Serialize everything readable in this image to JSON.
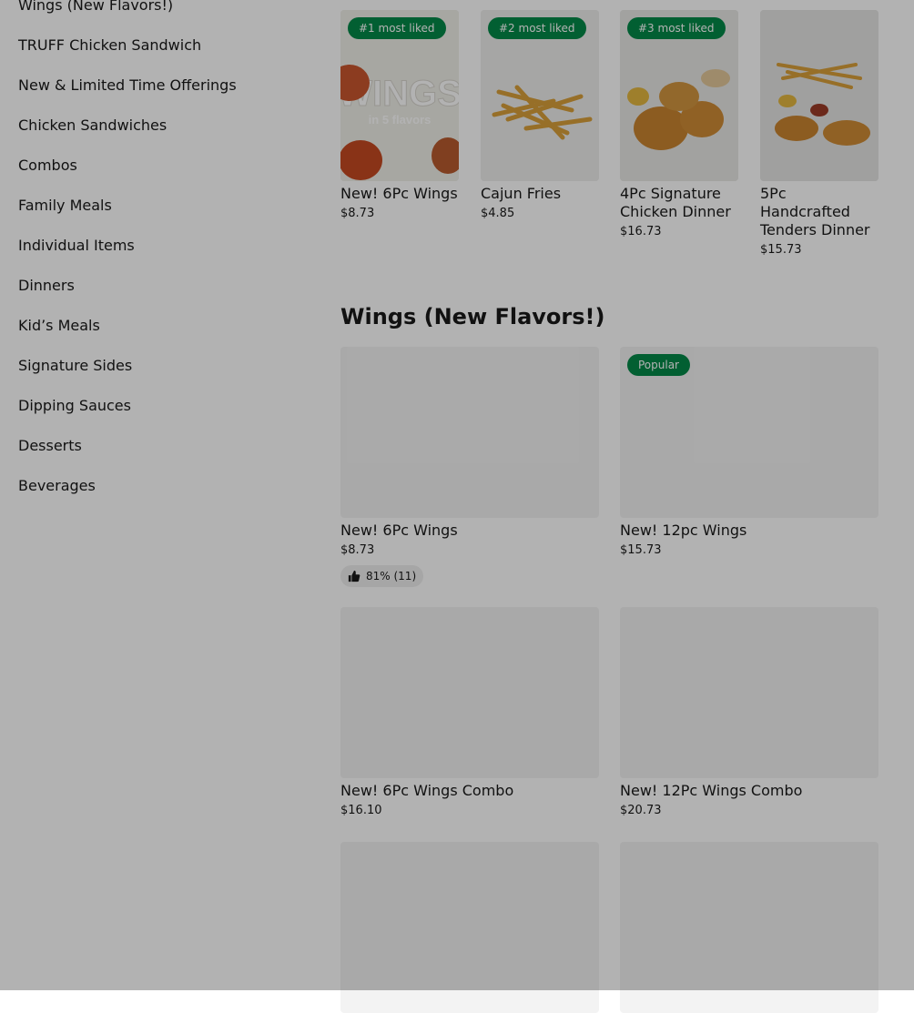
{
  "sidebar": {
    "items": [
      {
        "label": "Wings (New Flavors!)"
      },
      {
        "label": "TRUFF Chicken Sandwich"
      },
      {
        "label": "New & Limited Time Offerings"
      },
      {
        "label": "Chicken Sandwiches"
      },
      {
        "label": "Combos"
      },
      {
        "label": "Family Meals"
      },
      {
        "label": "Individual Items"
      },
      {
        "label": "Dinners"
      },
      {
        "label": "Kid’s Meals"
      },
      {
        "label": "Signature Sides"
      },
      {
        "label": "Dipping Sauces"
      },
      {
        "label": "Desserts"
      },
      {
        "label": "Beverages"
      }
    ]
  },
  "carousel": {
    "items": [
      {
        "badge": "#1 most liked",
        "name": "New! 6Pc Wings",
        "price": "$8.73",
        "image_text_1": "WINGS",
        "image_text_2": "in 5 flavors"
      },
      {
        "badge": "#2 most liked",
        "name": "Cajun Fries",
        "price": "$4.85"
      },
      {
        "badge": "#3 most liked",
        "name": "4Pc Signature Chicken Dinner",
        "price": "$16.73"
      },
      {
        "name": "5Pc Handcrafted Tenders Dinner",
        "price": "$15.73"
      }
    ]
  },
  "section": {
    "title": "Wings (New Flavors!)",
    "items": [
      {
        "name": "New! 6Pc Wings",
        "price": "$8.73",
        "rating": "81% (11)"
      },
      {
        "badge": "Popular",
        "name": "New! 12pc Wings",
        "price": "$15.73"
      },
      {
        "name": "New! 6Pc Wings Combo",
        "price": "$16.10"
      },
      {
        "name": "New! 12Pc Wings Combo",
        "price": "$20.73"
      }
    ]
  },
  "colors": {
    "badge": "#048848",
    "overlay": "rgba(0,0,0,0.3)"
  }
}
